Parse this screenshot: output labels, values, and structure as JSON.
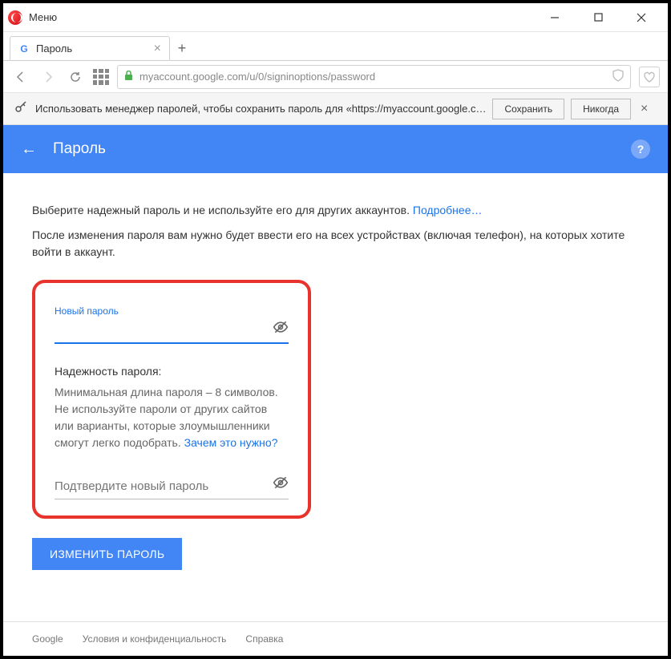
{
  "titlebar": {
    "menu": "Меню"
  },
  "tab": {
    "title": "Пароль"
  },
  "url": "myaccount.google.com/u/0/signinoptions/password",
  "banner": {
    "text": "Использовать менеджер паролей, чтобы сохранить пароль для «https://myaccount.google.c…",
    "save": "Сохранить",
    "never": "Никогда"
  },
  "header": {
    "title": "Пароль"
  },
  "intro": {
    "line1": "Выберите надежный пароль и не используйте его для других аккаунтов. ",
    "more": "Подробнее…",
    "line2": "После изменения пароля вам нужно будет ввести его на всех устройствах (включая телефон), на которых хотите войти в аккаунт."
  },
  "form": {
    "new_label": "Новый пароль",
    "strength_title": "Надежность пароля:",
    "strength_text": "Минимальная длина пароля – 8 символов. Не используйте пароли от других сайтов или варианты, которые злоумышленники смогут легко подобрать. ",
    "why_link": "Зачем это нужно?",
    "confirm_placeholder": "Подтвердите новый пароль",
    "submit": "ИЗМЕНИТЬ ПАРОЛЬ"
  },
  "footer": {
    "google": "Google",
    "privacy": "Условия и конфиденциальность",
    "help": "Справка"
  }
}
